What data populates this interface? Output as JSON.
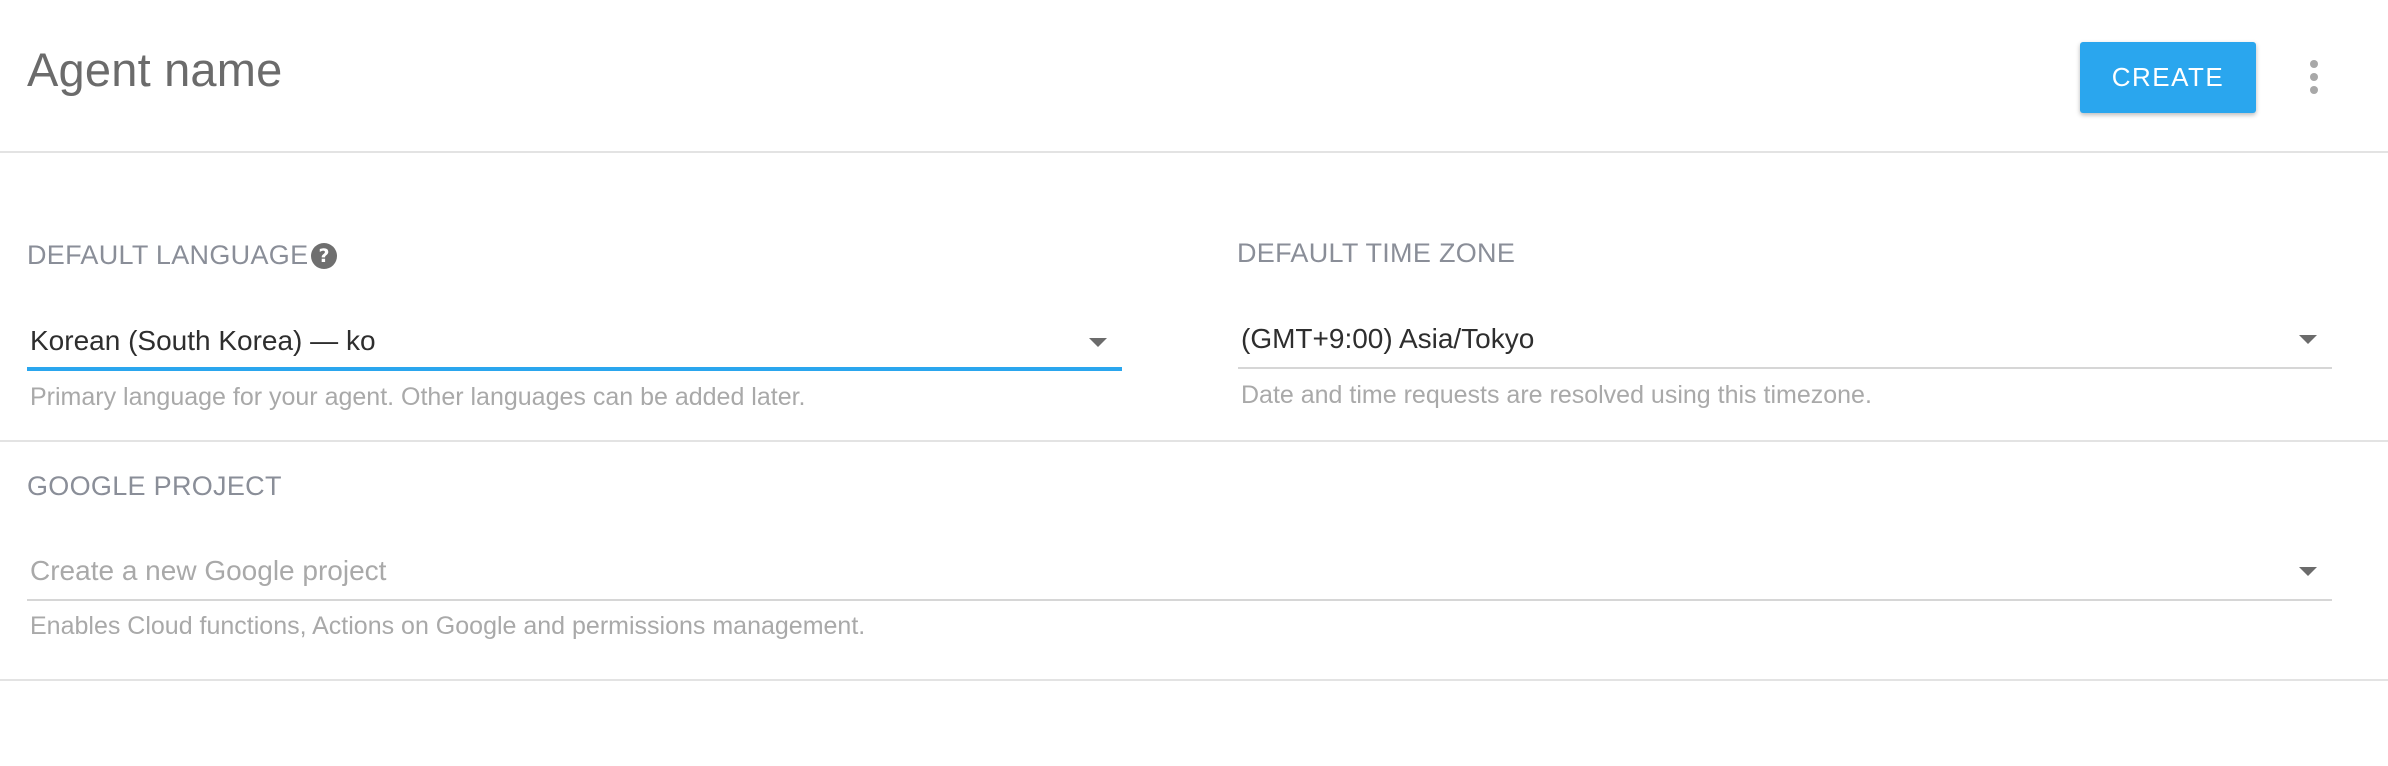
{
  "header": {
    "title": "Agent name",
    "create_label": "CREATE",
    "more_icon": "more-vertical-icon"
  },
  "language": {
    "label": "DEFAULT LANGUAGE",
    "help_icon": "?",
    "value": "Korean (South Korea) — ko",
    "hint": "Primary language for your agent. Other languages can be added later."
  },
  "timezone": {
    "label": "DEFAULT TIME ZONE",
    "value": "(GMT+9:00) Asia/Tokyo",
    "hint": "Date and time requests are resolved using this timezone."
  },
  "google_project": {
    "label": "GOOGLE PROJECT",
    "placeholder": "Create a new Google project",
    "hint": "Enables Cloud functions, Actions on Google and permissions management."
  },
  "colors": {
    "accent": "#2aa6ee",
    "label": "#8a8e98",
    "hint": "#a9a9a9",
    "divider": "#e3e3e3"
  }
}
